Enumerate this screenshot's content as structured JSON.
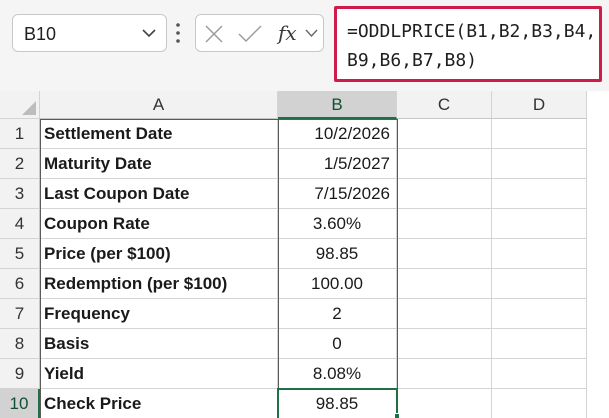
{
  "name_box": {
    "value": "B10",
    "dropdown_icon": "chevron-down-icon"
  },
  "formula_bar": {
    "cancel_icon": "cancel-x-icon",
    "enter_icon": "checkmark-icon",
    "fx_label": "fx",
    "fx_dropdown_icon": "chevron-down-icon",
    "formula": "=ODDLPRICE(B1,B2,B3,B4,B9,B6,B7,B8)"
  },
  "columns": [
    "A",
    "B",
    "C",
    "D"
  ],
  "selected_column": "B",
  "selected_row": "10",
  "rows": [
    {
      "num": "1",
      "label": "Settlement Date",
      "value": "10/2/2026"
    },
    {
      "num": "2",
      "label": "Maturity Date",
      "value": "1/5/2027"
    },
    {
      "num": "3",
      "label": "Last Coupon Date",
      "value": "7/15/2026"
    },
    {
      "num": "4",
      "label": "Coupon Rate",
      "value": "3.60%"
    },
    {
      "num": "5",
      "label": "Price (per $100)",
      "value": "98.85"
    },
    {
      "num": "6",
      "label": "Redemption (per $100)",
      "value": "100.00"
    },
    {
      "num": "7",
      "label": "Frequency",
      "value": "2"
    },
    {
      "num": "8",
      "label": "Basis",
      "value": "0"
    },
    {
      "num": "9",
      "label": "Yield",
      "value": "8.08%"
    },
    {
      "num": "10",
      "label": "Check Price",
      "value": "98.85"
    }
  ],
  "colors": {
    "accent_green": "#1e7145",
    "formula_highlight": "#d01b4b"
  }
}
